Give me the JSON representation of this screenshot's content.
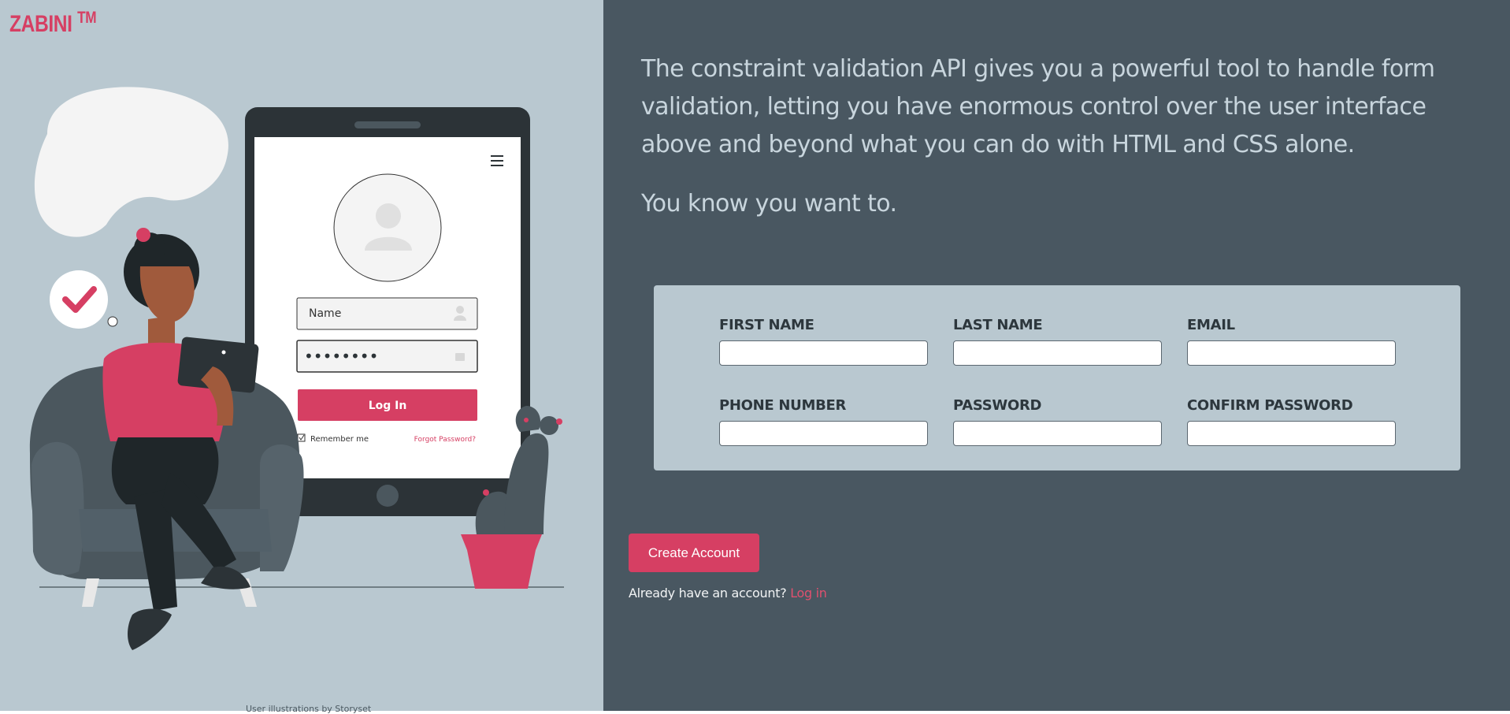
{
  "brand": {
    "name": "ZABINI",
    "tm": "TM"
  },
  "illustration": {
    "name_field": "Name",
    "password_field": "••••••••",
    "login_button": "Log In",
    "remember_me": "Remember me",
    "forgot_password": "Forgot Password?"
  },
  "credit": "User illustrations by Storyset",
  "intro": {
    "paragraph": "The constraint validation API gives you a powerful tool to handle form validation, letting you have enormous control over the user interface above and beyond what you can do with HTML and CSS alone.",
    "tagline": "You know you want to."
  },
  "form": {
    "first_name": "FIRST NAME",
    "last_name": "LAST NAME",
    "email": "EMAIL",
    "phone": "PHONE NUMBER",
    "password": "PASSWORD",
    "confirm_password": "CONFIRM PASSWORD"
  },
  "actions": {
    "create_account": "Create Account",
    "have_account": "Already have an account?",
    "log_in": "Log in"
  },
  "colors": {
    "accent": "#d63f63",
    "left_bg": "#b9c8d0",
    "right_bg": "#495761",
    "card_bg": "#b9c8d0"
  }
}
